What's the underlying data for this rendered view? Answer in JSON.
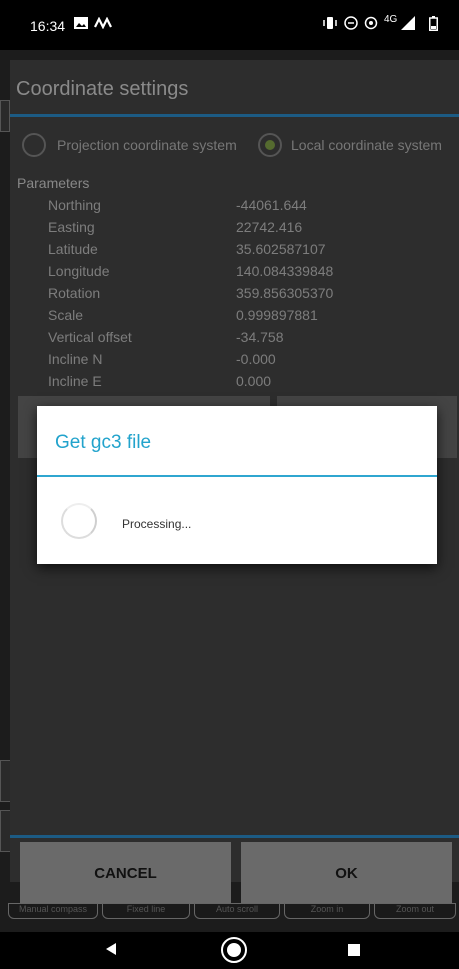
{
  "status_bar": {
    "time": "16:34",
    "network": "4G"
  },
  "coordinate_settings": {
    "title": "Coordinate settings",
    "radio_projection": "Projection coordinate system",
    "radio_local": "Local coordinate system",
    "parameters_label": "Parameters",
    "parameters": [
      {
        "name": "Northing",
        "value": "-44061.644"
      },
      {
        "name": "Easting",
        "value": "22742.416"
      },
      {
        "name": "Latitude",
        "value": "35.602587107"
      },
      {
        "name": "Longitude",
        "value": "140.084339848"
      },
      {
        "name": "Rotation",
        "value": "359.856305370"
      },
      {
        "name": "Scale",
        "value": "0.999897881"
      },
      {
        "name": "Vertical offset",
        "value": "-34.758"
      },
      {
        "name": "Incline N",
        "value": "-0.000"
      },
      {
        "name": "Incline E",
        "value": "0.000"
      }
    ],
    "cancel_label": "CANCEL",
    "ok_label": "OK"
  },
  "toolbar": {
    "items": [
      "Manual compass",
      "Fixed line",
      "Auto scroll",
      "Zoom in",
      "Zoom out"
    ]
  },
  "processing_dialog": {
    "title": "Get gc3 file",
    "message": "Processing..."
  },
  "colors": {
    "accent": "#22a3cc",
    "rule": "#1c5b84"
  }
}
